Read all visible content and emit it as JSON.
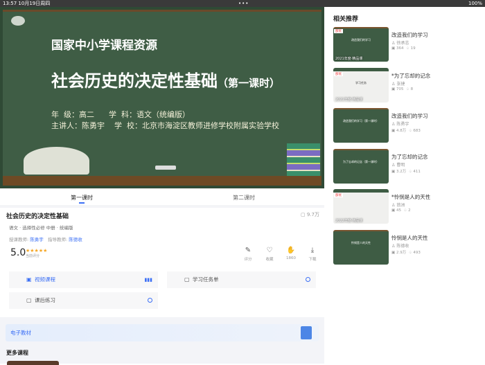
{
  "status": {
    "time": "13:57",
    "date": "10月19日周四",
    "dots": "•••",
    "battery": "100%"
  },
  "board": {
    "org": "国家中小学课程资源",
    "title": "社会历史的决定性基础",
    "title_suffix": "（第一课时）",
    "line1": "年  级：高二      学  科：语文（统编版）",
    "line2": "主讲人：陈勇宇    学  校：北京市海淀区教师进修学校附属实验学校"
  },
  "tabs": [
    "第一课时",
    "第二课时"
  ],
  "lesson": {
    "title": "社会历史的决定性基础",
    "views": "9.7万",
    "meta": "语文 · 选择性必修 中册 · 统编版",
    "teacher_label": "授课教师:",
    "teacher": "陈勇宇",
    "guide_label": "指导教师:",
    "guide": "陈德收",
    "score": "5.0",
    "stars": "★★★★★",
    "score_label": "当前评分"
  },
  "actions": [
    {
      "icon": "comment-icon",
      "glyph": "✎",
      "label": "评分"
    },
    {
      "icon": "heart-icon",
      "glyph": "♡",
      "label": "收藏"
    },
    {
      "icon": "thumbs-up-icon",
      "glyph": "👍",
      "label": "1860"
    },
    {
      "icon": "download-icon",
      "glyph": "⤓",
      "label": "下载"
    }
  ],
  "resources": [
    {
      "label": "视频课程",
      "active": true
    },
    {
      "label": "学习任务单"
    },
    {
      "label": "课后练习"
    }
  ],
  "ebook": "电子教材",
  "more": "更多课程",
  "side": {
    "title": "相关推荐",
    "items": [
      {
        "title": "改造我们的学习",
        "author": "徐承志",
        "views": "364",
        "likes": "19",
        "badge": "部优",
        "year": "2021年度·精品课",
        "thumb": "改造我们的学习"
      },
      {
        "title": "*为了忘却的记念",
        "author": "张捷",
        "views": "705",
        "likes": "8",
        "badge": "部优",
        "year": "2021年度·精品课",
        "thumb": "学习任务"
      },
      {
        "title": "改造我们的学习",
        "author": "陈勇宇",
        "views": "4.8万",
        "likes": "683",
        "thumb": "改造我们的学习（第一课时）"
      },
      {
        "title": "为了忘却的记念",
        "author": "曹明",
        "views": "3.2万",
        "likes": "411",
        "thumb": "为了忘却的记念（第一课时）"
      },
      {
        "title": "*怜悯是人的天性",
        "author": "翁洲",
        "views": "45",
        "likes": "2",
        "badge": "部优",
        "year": "2022年度·精品课",
        "thumb": ""
      },
      {
        "title": "怜悯是人的天性",
        "author": "陈德收",
        "views": "2.9万",
        "likes": "493",
        "thumb": "怜悯是人的天性"
      }
    ]
  }
}
